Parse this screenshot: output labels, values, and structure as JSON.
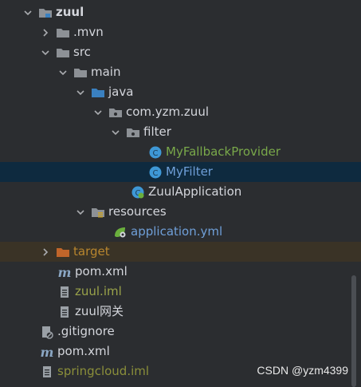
{
  "tree": {
    "items": [
      {
        "label": "zuul",
        "color": "#d4d6dc"
      },
      {
        "label": ".mvn"
      },
      {
        "label": "src"
      },
      {
        "label": "main"
      },
      {
        "label": "java"
      },
      {
        "label": "com.yzm.zuul"
      },
      {
        "label": "filter"
      },
      {
        "label": "MyFallbackProvider"
      },
      {
        "label": "MyFilter"
      },
      {
        "label": "ZuulApplication"
      },
      {
        "label": "resources"
      },
      {
        "label": "application.yml"
      },
      {
        "label": "target"
      },
      {
        "label": "pom.xml"
      },
      {
        "label": "zuul.iml"
      },
      {
        "label": "zuul网关"
      },
      {
        "label": ".gitignore"
      },
      {
        "label": "pom.xml"
      },
      {
        "label": "springcloud.iml"
      }
    ]
  },
  "colors": {
    "background": "#2b2d30",
    "selected": "#0e2a3f",
    "excluded": "#3a3326",
    "folder": "#8d9196",
    "folder_source": "#3a80c0",
    "folder_excluded": "#c0652a",
    "class_icon": "#3e98d6"
  },
  "watermark": "CSDN @yzm4399"
}
